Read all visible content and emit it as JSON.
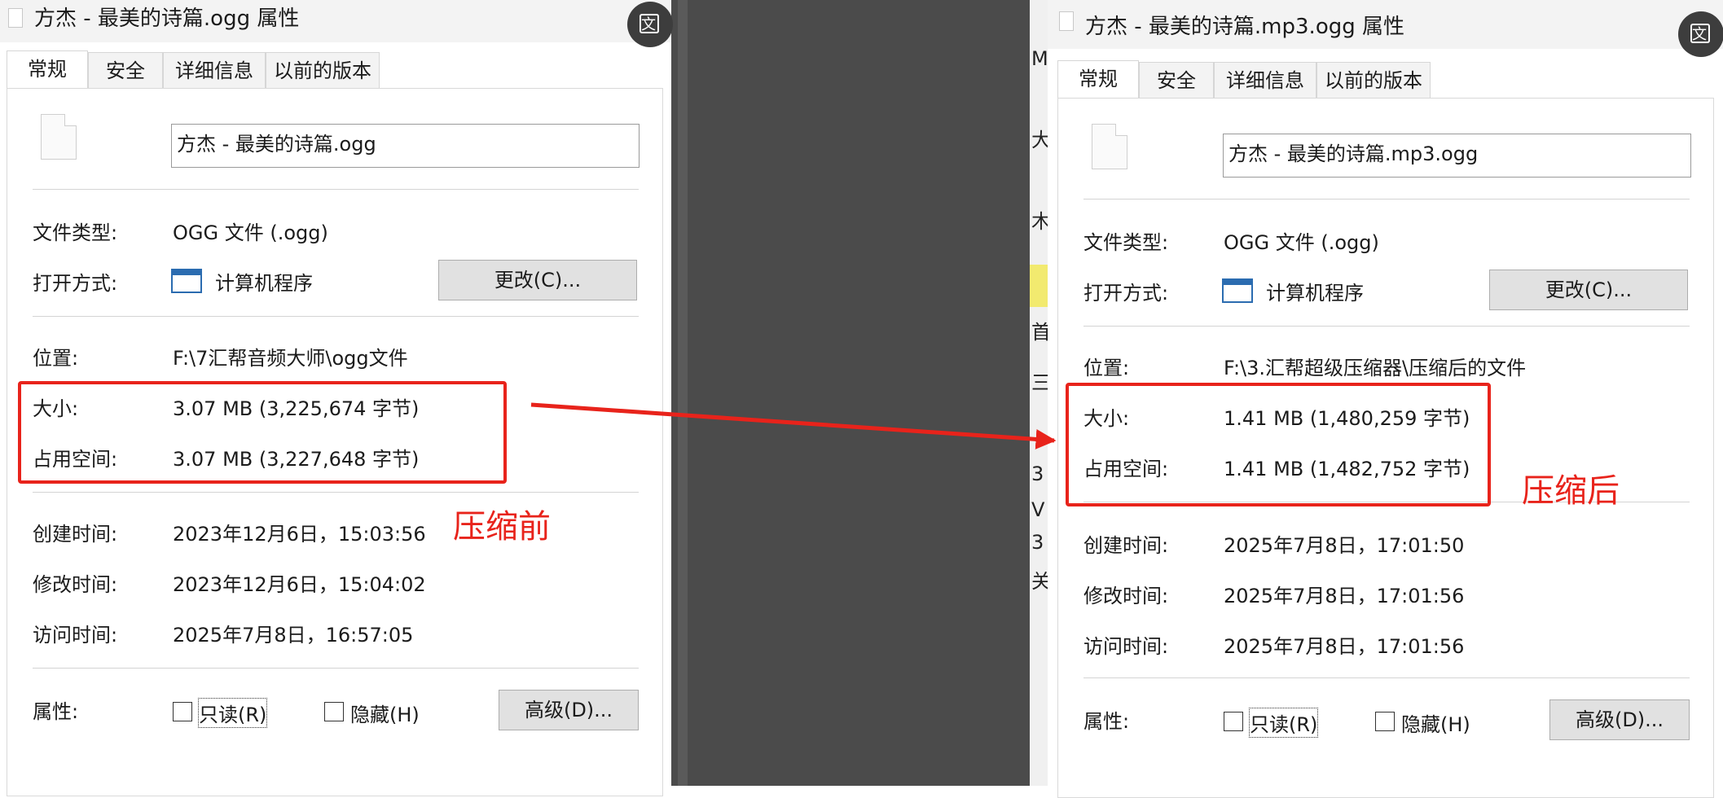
{
  "left": {
    "title": "方杰 - 最美的诗篇.ogg 属性",
    "tabs": [
      "常规",
      "安全",
      "详细信息",
      "以前的版本"
    ],
    "filename": "方杰 - 最美的诗篇.ogg",
    "file_type_label": "文件类型:",
    "file_type": "OGG 文件 (.ogg)",
    "open_with_label": "打开方式:",
    "open_with": "计算机程序",
    "change_button": "更改(C)...",
    "location_label": "位置:",
    "location": "F:\\7汇帮音频大师\\ogg文件",
    "size_label": "大小:",
    "size": "3.07 MB (3,225,674 字节)",
    "disk_size_label": "占用空间:",
    "disk_size": "3.07 MB (3,227,648 字节)",
    "created_label": "创建时间:",
    "created": "2023年12月6日，15:03:56",
    "modified_label": "修改时间:",
    "modified": "2023年12月6日，15:04:02",
    "accessed_label": "访问时间:",
    "accessed": "2025年7月8日，16:57:05",
    "attributes_label": "属性:",
    "readonly": "只读(R)",
    "hidden": "隐藏(H)",
    "advanced_button": "高级(D)...",
    "annotation": "压缩前"
  },
  "right": {
    "title": "方杰 - 最美的诗篇.mp3.ogg 属性",
    "tabs": [
      "常规",
      "安全",
      "详细信息",
      "以前的版本"
    ],
    "filename": "方杰 - 最美的诗篇.mp3.ogg",
    "file_type_label": "文件类型:",
    "file_type": "OGG 文件 (.ogg)",
    "open_with_label": "打开方式:",
    "open_with": "计算机程序",
    "change_button": "更改(C)...",
    "location_label": "位置:",
    "location": "F:\\3.汇帮超级压缩器\\压缩后的文件",
    "size_label": "大小:",
    "size": "1.41 MB (1,480,259 字节)",
    "disk_size_label": "占用空间:",
    "disk_size": "1.41 MB (1,482,752 字节)",
    "created_label": "创建时间:",
    "created": "2025年7月8日，17:01:50",
    "modified_label": "修改时间:",
    "modified": "2025年7月8日，17:01:56",
    "accessed_label": "访问时间:",
    "accessed": "2025年7月8日，17:01:56",
    "attributes_label": "属性:",
    "readonly": "只读(R)",
    "hidden": "隐藏(H)",
    "advanced_button": "高级(D)...",
    "annotation": "压缩后"
  },
  "background_glyphs": [
    "M",
    "大",
    "木",
    "首",
    "三",
    "3",
    "V",
    "3",
    "关"
  ],
  "close_glyph": "文",
  "colors": {
    "annotation_red": "#e8231b",
    "backdrop": "#4b4b4b",
    "app_icon_blue": "#2b6cb0"
  }
}
